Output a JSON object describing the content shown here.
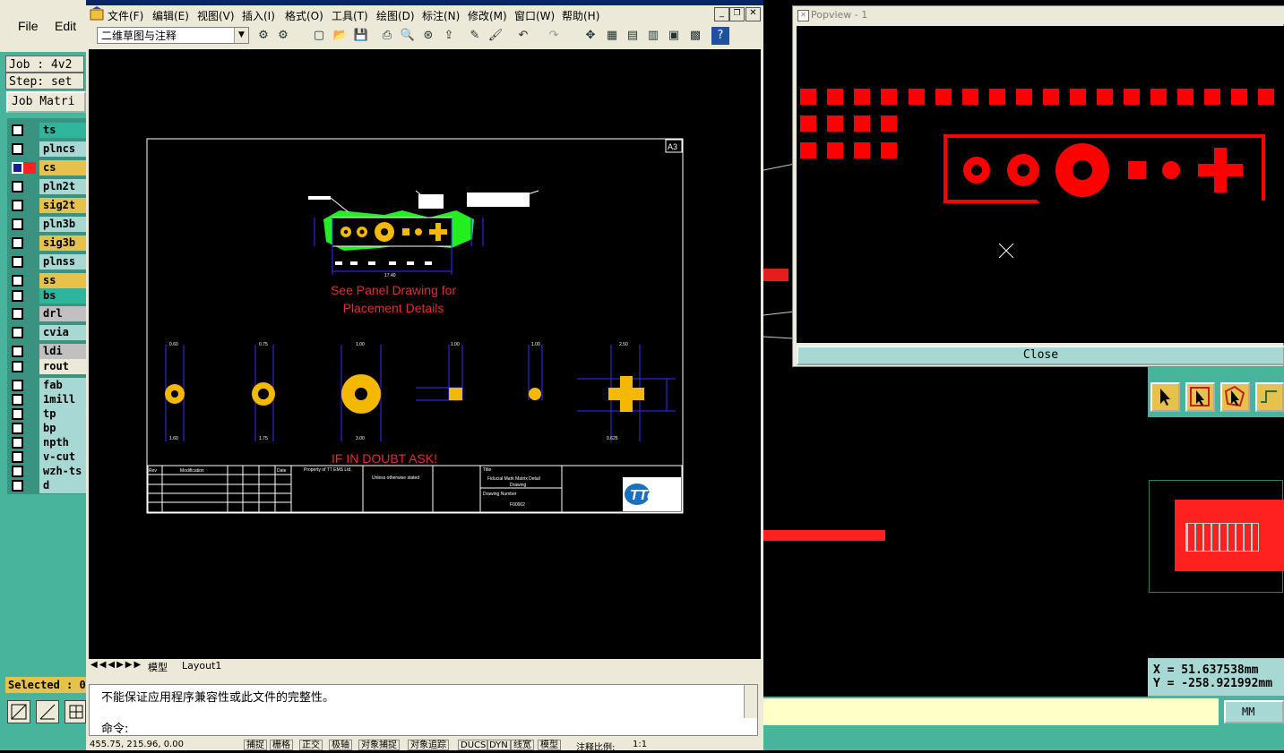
{
  "left_app": {
    "menu": [
      "File",
      "Edit"
    ],
    "job_line": "Job : 4v2",
    "step_line": "Step: set",
    "job_matrix_label": "Job Matri",
    "layers": [
      {
        "name": "ts",
        "color": "#2fb59c",
        "checked": false
      },
      {
        "name": "plncs",
        "color": "#a8d8d4",
        "checked": false
      },
      {
        "name": "cs",
        "color": "#e6c24c",
        "checked": true
      },
      {
        "name": "pln2t",
        "color": "#a8d8d4",
        "checked": false
      },
      {
        "name": "sig2t",
        "color": "#e6c24c",
        "checked": false
      },
      {
        "name": "pln3b",
        "color": "#a8d8d4",
        "checked": false
      },
      {
        "name": "sig3b",
        "color": "#e6c24c",
        "checked": false
      },
      {
        "name": "plnss",
        "color": "#a8d8d4",
        "checked": false
      },
      {
        "name": "ss",
        "color": "#e6c24c",
        "checked": false
      },
      {
        "name": "bs",
        "color": "#2fb59c",
        "checked": false
      },
      {
        "name": "drl",
        "color": "#c0c0c0",
        "checked": false
      },
      {
        "name": "cvia",
        "color": "#a8d8d4",
        "checked": false
      },
      {
        "name": "ldi",
        "color": "#c0c0c0",
        "checked": false
      },
      {
        "name": "rout",
        "color": "#ece9d8",
        "checked": false
      },
      {
        "name": "fab",
        "color": "#a8d8d4",
        "checked": false
      },
      {
        "name": "1mill",
        "color": "#a8d8d4",
        "checked": false
      },
      {
        "name": "tp",
        "color": "#a8d8d4",
        "checked": false
      },
      {
        "name": "bp",
        "color": "#a8d8d4",
        "checked": false
      },
      {
        "name": "npth",
        "color": "#a8d8d4",
        "checked": false
      },
      {
        "name": "v-cut",
        "color": "#a8d8d4",
        "checked": false
      },
      {
        "name": "wzh-ts",
        "color": "#a8d8d4",
        "checked": false
      },
      {
        "name": "d",
        "color": "#a8d8d4",
        "checked": false
      }
    ],
    "selected_label": "Selected : 0"
  },
  "acad": {
    "menu": [
      "文件(F)",
      "编辑(E)",
      "视图(V)",
      "插入(I)",
      "格式(O)",
      "工具(T)",
      "绘图(D)",
      "标注(N)",
      "修改(M)",
      "窗口(W)",
      "帮助(H)"
    ],
    "workspace": "二维草图与注释",
    "drawing": {
      "sheet_size": "A3",
      "note_line1": "See Panel Drawing for",
      "note_line2": "Placement Details",
      "warning": "IF IN DOUBT ASK!",
      "title_label": "Title",
      "title_value1": "Fiducial Mark Matrix Detail",
      "title_value2": "Drawing",
      "drawing_number_label": "Drawing Number",
      "drawing_number": "F00002",
      "rev_label": "Rev",
      "modification_label": "Modification",
      "date_label": "Date",
      "property_text": "Property of TT EMS Ltd.",
      "unless_text": "Unless otherwise stated",
      "logo_text": "TTems",
      "dims": [
        "0.60",
        "0.75",
        "1.00",
        "1.00",
        "1.00",
        "2.50",
        "1.60",
        "1.75",
        "3.00",
        "0.625",
        "17.40"
      ]
    },
    "layout_tabs": [
      "模型",
      "Layout1"
    ],
    "command_message": "不能保证应用程序兼容性或此文件的完整性。",
    "command_prompt": "命令:",
    "status_coords": "455.75, 215.96, 0.00",
    "status_buttons": [
      "捕捉",
      "栅格",
      "正交",
      "极轴",
      "对象捕捉",
      "对象追踪",
      "DUCS",
      "DYN",
      "线宽",
      "模型"
    ],
    "annotation_scale_label": "注释比例:",
    "annotation_scale": "1:1"
  },
  "popview": {
    "title": "Popview - 1",
    "close_label": "Close"
  },
  "right_panel": {
    "x_readout": "X =  51.637538mm",
    "y_readout": "Y = -258.921992mm",
    "units_button": "MM"
  },
  "colors": {
    "cam_green": "#48b49c",
    "cam_cyan": "#a8d8d4",
    "fiducial_red": "#ff0000",
    "pad_yellow": "#f5b800"
  }
}
